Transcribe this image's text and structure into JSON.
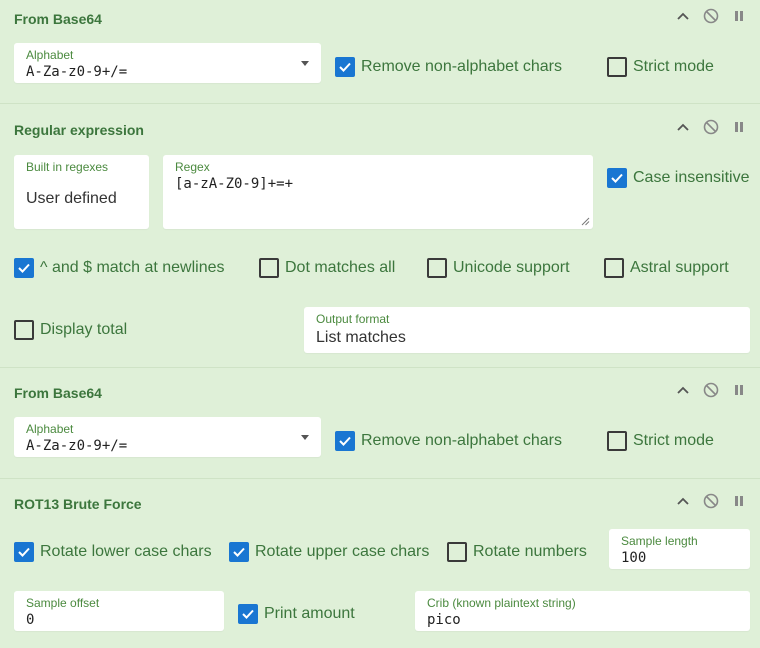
{
  "ops": [
    {
      "title": "From Base64",
      "alphabet_label": "Alphabet",
      "alphabet_value": "A-Za-z0-9+/=",
      "remove_non_alphabet_label": "Remove non-alphabet chars",
      "remove_non_alphabet_checked": true,
      "strict_mode_label": "Strict mode",
      "strict_mode_checked": false
    },
    {
      "title": "Regular expression",
      "builtin_label": "Built in regexes",
      "builtin_value": "User defined",
      "regex_label": "Regex",
      "regex_value": "[a-zA-Z0-9]+=+",
      "case_insensitive_label": "Case insensitive",
      "case_insensitive_checked": true,
      "multiline_label": "^ and $ match at newlines",
      "multiline_checked": true,
      "dotall_label": "Dot matches all",
      "dotall_checked": false,
      "unicode_label": "Unicode support",
      "unicode_checked": false,
      "astral_label": "Astral support",
      "astral_checked": false,
      "display_total_label": "Display total",
      "display_total_checked": false,
      "output_format_label": "Output format",
      "output_format_value": "List matches"
    },
    {
      "title": "From Base64",
      "alphabet_label": "Alphabet",
      "alphabet_value": "A-Za-z0-9+/=",
      "remove_non_alphabet_label": "Remove non-alphabet chars",
      "remove_non_alphabet_checked": true,
      "strict_mode_label": "Strict mode",
      "strict_mode_checked": false
    },
    {
      "title": "ROT13 Brute Force",
      "rotate_lower_label": "Rotate lower case chars",
      "rotate_lower_checked": true,
      "rotate_upper_label": "Rotate upper case chars",
      "rotate_upper_checked": true,
      "rotate_numbers_label": "Rotate numbers",
      "rotate_numbers_checked": false,
      "sample_length_label": "Sample length",
      "sample_length_value": "100",
      "sample_offset_label": "Sample offset",
      "sample_offset_value": "0",
      "print_amount_label": "Print amount",
      "print_amount_checked": true,
      "crib_label": "Crib (known plaintext string)",
      "crib_value": "pico"
    }
  ],
  "icons": {
    "collapse": "chevron-up-icon",
    "disable": "disable-icon",
    "breakpoint": "pause-icon"
  },
  "colors": {
    "background": "#dff0d8",
    "title": "#3c763d",
    "checkbox_on": "#1976d2",
    "field_bg": "#ffffff"
  }
}
